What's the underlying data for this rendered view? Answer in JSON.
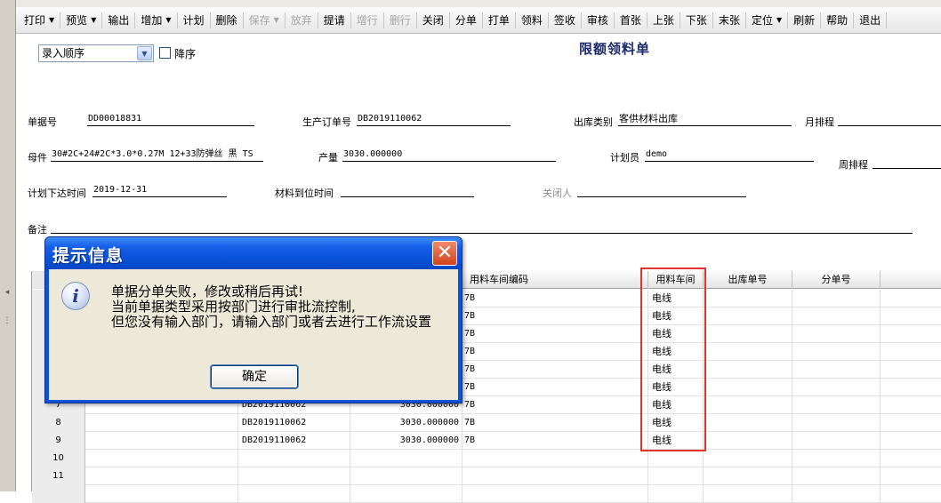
{
  "toolbar": {
    "items": [
      {
        "label": "打印",
        "dropdown": true,
        "enabled": true
      },
      {
        "label": "预览",
        "dropdown": true,
        "enabled": true
      },
      {
        "label": "输出",
        "dropdown": false,
        "enabled": true
      },
      {
        "label": "增加",
        "dropdown": true,
        "enabled": true
      },
      {
        "label": "计划",
        "dropdown": false,
        "enabled": true
      },
      {
        "label": "删除",
        "dropdown": false,
        "enabled": true
      },
      {
        "label": "保存",
        "dropdown": true,
        "enabled": false
      },
      {
        "label": "放弃",
        "dropdown": false,
        "enabled": false
      },
      {
        "label": "提请",
        "dropdown": false,
        "enabled": true
      },
      {
        "label": "增行",
        "dropdown": false,
        "enabled": false
      },
      {
        "label": "删行",
        "dropdown": false,
        "enabled": false
      },
      {
        "label": "关闭",
        "dropdown": false,
        "enabled": true
      },
      {
        "label": "分单",
        "dropdown": false,
        "enabled": true
      },
      {
        "label": "打单",
        "dropdown": false,
        "enabled": true
      },
      {
        "label": "领料",
        "dropdown": false,
        "enabled": true
      },
      {
        "label": "签收",
        "dropdown": false,
        "enabled": true
      },
      {
        "label": "审核",
        "dropdown": false,
        "enabled": true
      },
      {
        "label": "首张",
        "dropdown": false,
        "enabled": true
      },
      {
        "label": "上张",
        "dropdown": false,
        "enabled": true
      },
      {
        "label": "下张",
        "dropdown": false,
        "enabled": true
      },
      {
        "label": "末张",
        "dropdown": false,
        "enabled": true
      },
      {
        "label": "定位",
        "dropdown": true,
        "enabled": true
      },
      {
        "label": "刷新",
        "dropdown": false,
        "enabled": true
      },
      {
        "label": "帮助",
        "dropdown": false,
        "enabled": true
      },
      {
        "label": "退出",
        "dropdown": false,
        "enabled": true
      }
    ]
  },
  "form": {
    "sort_value": "录入顺序",
    "desc_label": "降序",
    "title": "限额领料单",
    "doc_no_label": "单据号",
    "doc_no": "DD00018831",
    "prod_order_label": "生产订单号",
    "prod_order": "DB2019110062",
    "out_type_label": "出库类别",
    "out_type": "客供材料出库",
    "month_label": "月排程",
    "month": "",
    "parent_label": "母件",
    "parent": "30#2C+24#2C*3.0*0.27M 12+33防弹丝 黑 TS",
    "qty_label": "产量",
    "qty": "3030.000000",
    "planner_label": "计划员",
    "planner": "demo",
    "week_label": "周排程",
    "week": "",
    "issue_time_label": "计划下达时间",
    "issue_time": "2019-12-31",
    "arrival_label": "材料到位时间",
    "arrival": "",
    "closer_label": "关闭人",
    "closer": "",
    "remark_label": "备注",
    "remark": ""
  },
  "grid": {
    "headers": [
      "用料车间编码",
      "用料车间",
      "出库单号",
      "分单号"
    ],
    "rows": [
      {
        "num": "",
        "order": "",
        "qty": "",
        "code": "7B",
        "ws": "电线"
      },
      {
        "num": "",
        "order": "",
        "qty": "",
        "code": "7B",
        "ws": "电线"
      },
      {
        "num": "",
        "order": "",
        "qty": "",
        "code": "7B",
        "ws": "电线"
      },
      {
        "num": "",
        "order": "",
        "qty": "",
        "code": "7B",
        "ws": "电线"
      },
      {
        "num": "",
        "order": "",
        "qty": "",
        "code": "7B",
        "ws": "电线"
      },
      {
        "num": "",
        "order": "",
        "qty": "",
        "code": "7B",
        "ws": "电线"
      },
      {
        "num": "7",
        "order": "DB2019110062",
        "qty": "3030.000000",
        "code": "7B",
        "ws": "电线"
      },
      {
        "num": "8",
        "order": "DB2019110062",
        "qty": "3030.000000",
        "code": "7B",
        "ws": "电线"
      },
      {
        "num": "9",
        "order": "DB2019110062",
        "qty": "3030.000000",
        "code": "7B",
        "ws": "电线"
      },
      {
        "num": "10",
        "order": "",
        "qty": "",
        "code": "",
        "ws": ""
      },
      {
        "num": "11",
        "order": "",
        "qty": "",
        "code": "",
        "ws": ""
      },
      {
        "num": "",
        "order": "",
        "qty": "",
        "code": "",
        "ws": ""
      }
    ]
  },
  "dialog": {
    "title": "提示信息",
    "line1": "单据分单失败，修改或稍后再试!",
    "line2": "当前单据类型采用按部门进行审批流控制,",
    "line3": "但您没有输入部门，请输入部门或者去进行工作流设置",
    "ok_label": "确定"
  }
}
